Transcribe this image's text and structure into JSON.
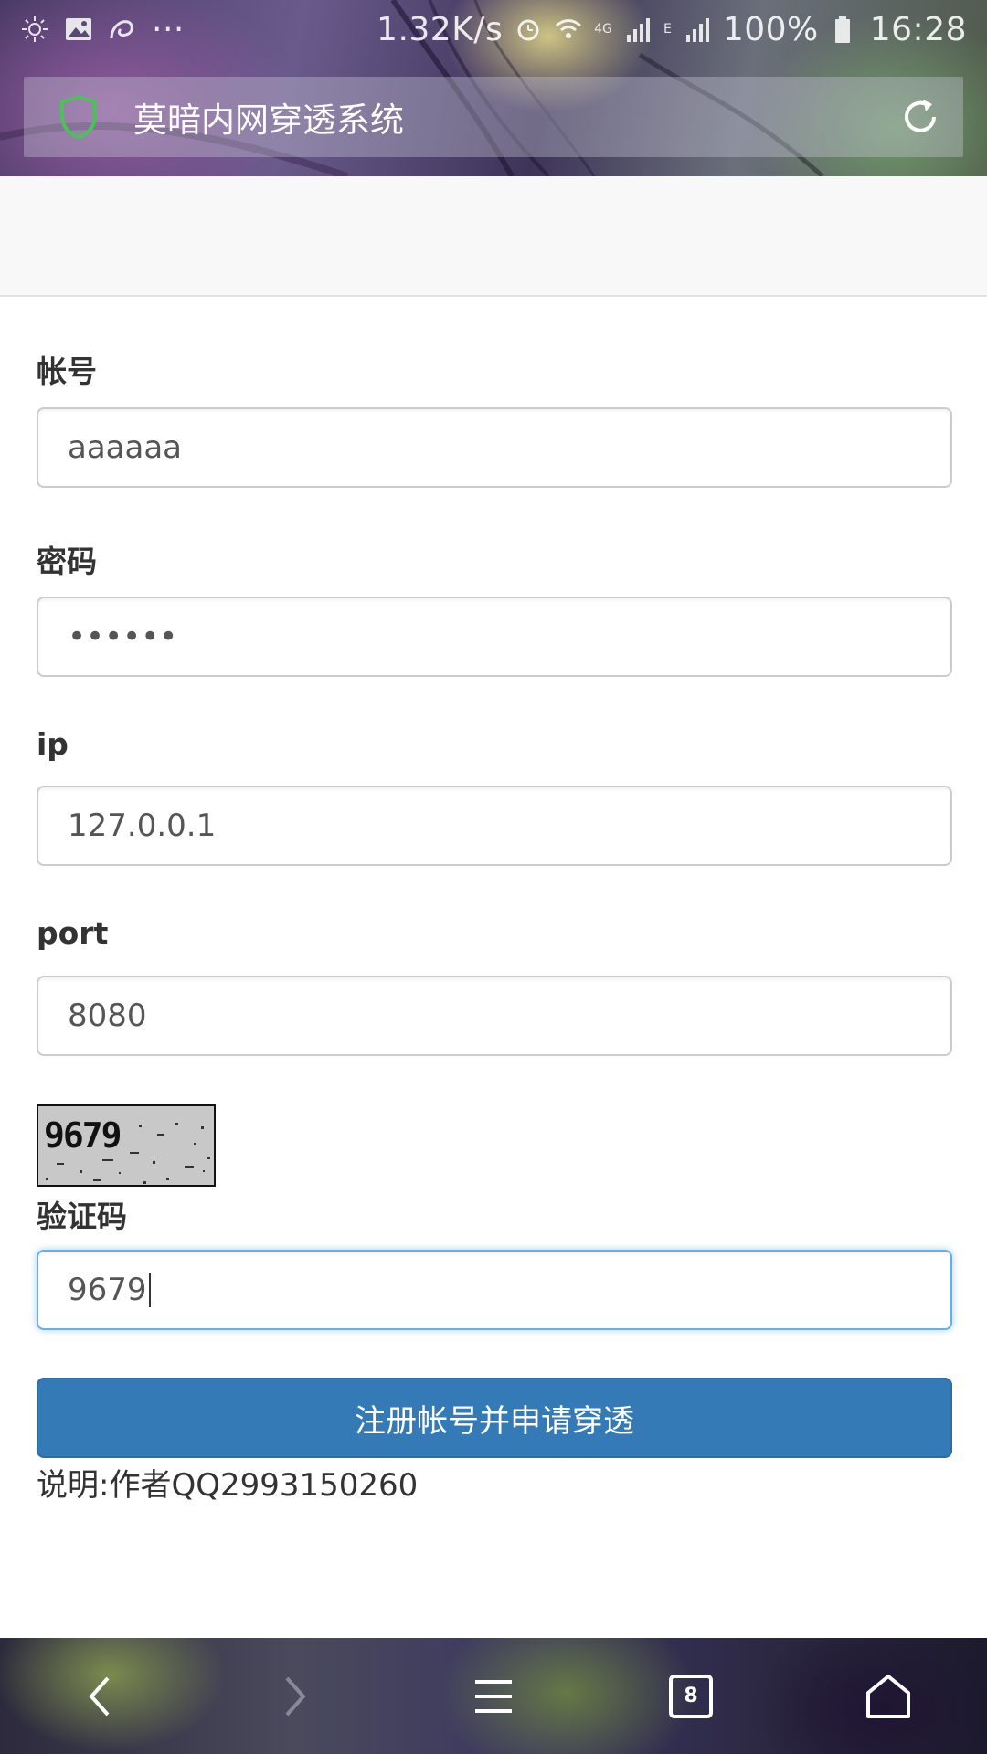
{
  "status_bar": {
    "network_speed": "1.32K/s",
    "network_type": "4G",
    "network_type_2": "E",
    "battery": "100%",
    "time": "16:28"
  },
  "browser": {
    "page_title": "莫暗内网穿透系统"
  },
  "form": {
    "account": {
      "label": "帐号",
      "value": "aaaaaa"
    },
    "password": {
      "label": "密码",
      "value": "••••••"
    },
    "ip": {
      "label": "ip",
      "value": "127.0.0.1"
    },
    "port": {
      "label": "port",
      "value": "8080"
    },
    "captcha": {
      "image_text": "9679",
      "label": "验证码",
      "value": "9679"
    },
    "submit_label": "注册帐号并申请穿透",
    "note": "说明:作者QQ2993150260"
  },
  "bottom_nav": {
    "tab_count": "8"
  },
  "colors": {
    "primary": "#337ab7",
    "focus": "#66afe9",
    "shield": "#4cc15a"
  }
}
